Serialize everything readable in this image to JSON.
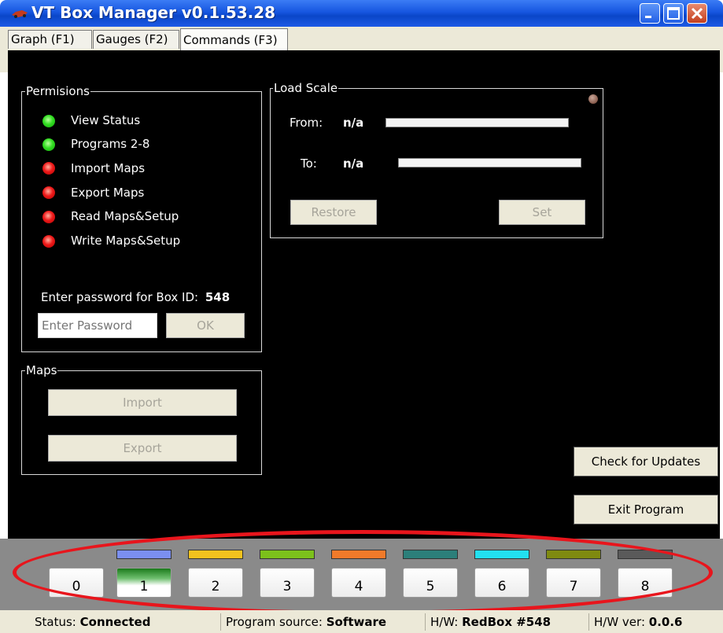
{
  "window": {
    "title": "VT Box Manager v0.1.53.28",
    "minimize_icon": "minimize-icon",
    "maximize_icon": "maximize-icon",
    "close_icon": "close-icon"
  },
  "tabs": [
    {
      "label": "Graph (F1)"
    },
    {
      "label": "Gauges (F2)"
    },
    {
      "label": "Commands (F3)"
    }
  ],
  "permissions": {
    "title": "Permisions",
    "items": [
      {
        "label": "View Status",
        "status": "green"
      },
      {
        "label": "Programs 2-8",
        "status": "green"
      },
      {
        "label": "Import Maps",
        "status": "red"
      },
      {
        "label": "Export Maps",
        "status": "red"
      },
      {
        "label": "Read Maps&Setup",
        "status": "red"
      },
      {
        "label": "Write Maps&Setup",
        "status": "red"
      }
    ],
    "password_prompt": "Enter password for Box ID:",
    "box_id": "548",
    "password_placeholder": "Enter Password",
    "ok_label": "OK"
  },
  "load_scale": {
    "title": "Load Scale",
    "from_label": "From:",
    "from_value": "n/a",
    "to_label": "To:",
    "to_value": "n/a",
    "restore_label": "Restore",
    "set_label": "Set"
  },
  "maps": {
    "title": "Maps",
    "import_label": "Import",
    "export_label": "Export"
  },
  "actions": {
    "check_updates_label": "Check for Updates",
    "exit_label": "Exit Program"
  },
  "programs": {
    "selected": "1",
    "items": [
      {
        "label": "0",
        "color": null
      },
      {
        "label": "1",
        "color": "#7b8ff0"
      },
      {
        "label": "2",
        "color": "#f2c21e"
      },
      {
        "label": "3",
        "color": "#7cc11b"
      },
      {
        "label": "4",
        "color": "#f07a2a"
      },
      {
        "label": "5",
        "color": "#2c7f7a"
      },
      {
        "label": "6",
        "color": "#22e0f0"
      },
      {
        "label": "7",
        "color": "#7f8a10"
      },
      {
        "label": "8",
        "color": "#5a5a5a"
      }
    ]
  },
  "status_bar": {
    "status_label": "Status:",
    "status_value": "Connected",
    "source_label": "Program source:",
    "source_value": "Software",
    "hw_label": "H/W:",
    "hw_value": "RedBox #548",
    "hwver_label": "H/W ver:",
    "hwver_value": "0.0.6"
  },
  "colors": {
    "highlight": "#e8151c",
    "panel": "#000000"
  }
}
